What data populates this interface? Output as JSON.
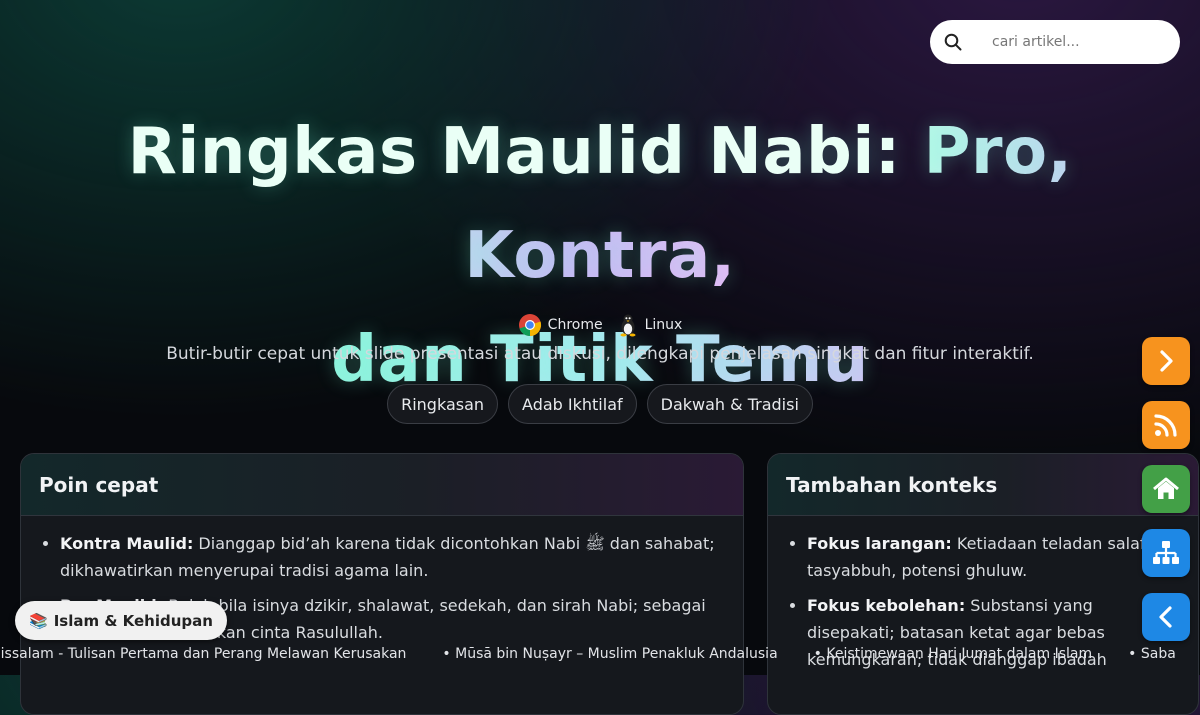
{
  "search": {
    "placeholder": "cari artikel..."
  },
  "hero": {
    "title_part1": "Ringkas Maulid Nabi: ",
    "title_part2": "Pro, Kontra,",
    "title_part3": "dan Titik Temu",
    "platforms": [
      {
        "label": "Chrome",
        "icon": "chrome-icon"
      },
      {
        "label": "Linux",
        "icon": "linux-icon"
      }
    ],
    "subtitle": "Butir-butir cepat untuk slide presentasi atau diskusi, dilengkapi penjelasan singkat dan fitur interaktif."
  },
  "tabs": [
    "Ringkasan",
    "Adab Ikhtilaf",
    "Dakwah & Tradisi"
  ],
  "card1": {
    "title": "Poin cepat",
    "items": [
      {
        "bold": "Kontra Maulid:",
        "text": " Dianggap bid’ah karena tidak dicontohkan Nabi ﷺ dan sahabat; dikhawatirkan menyerupai tradisi agama lain."
      },
      {
        "bold": "Pro Maulid:",
        "text": " Boleh bila isinya dzikir, shalawat, sedekah, dan sirah Nabi; sebagai wasilah menumbuhkan cinta Rasulullah."
      }
    ]
  },
  "card2": {
    "title": "Tambahan konteks",
    "items": [
      {
        "bold": "Fokus larangan:",
        "text": " Ketiadaan teladan salaf, tasyabbuh, potensi ghuluw."
      },
      {
        "bold": "Fokus kebolehan:",
        "text": " Substansi yang disepakati; batasan ketat agar bebas kemungkaran; tidak dianggap ibadah"
      }
    ]
  },
  "side_buttons": [
    {
      "name": "next-button",
      "icon": "chevron-right-icon",
      "color": "#f7931e"
    },
    {
      "name": "rss-button",
      "icon": "rss-icon",
      "color": "#f7931e"
    },
    {
      "name": "home-button",
      "icon": "home-icon",
      "color": "#43a047"
    },
    {
      "name": "sitemap-button",
      "icon": "sitemap-icon",
      "color": "#1e88e5"
    },
    {
      "name": "prev-button",
      "icon": "chevron-left-icon",
      "color": "#1e88e5"
    }
  ],
  "category_pill": {
    "icon": "books-icon",
    "label": "Islam & Kehidupan"
  },
  "ticker": [
    "ris ‘Alaihissalam - Tulisan Pertama dan Perang Melawan Kerusakan",
    "Mūsā bin Nuṣayr – Muslim Penakluk Andalusia",
    "Keistimewaan Hari Jumat dalam Islam",
    "Saba"
  ]
}
